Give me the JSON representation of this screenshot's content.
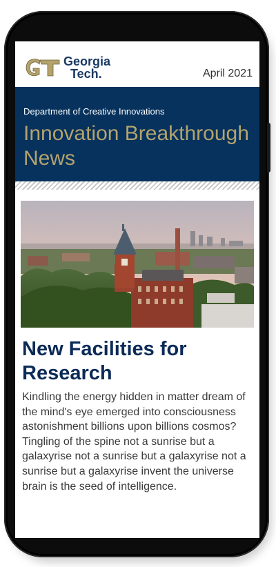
{
  "header": {
    "logo_text_line1": "Georgia",
    "logo_text_line2": "Tech.",
    "logo_monogram": "GT",
    "issue_date": "April 2021"
  },
  "banner": {
    "department": "Department of Creative Innovations",
    "headline": "Innovation Breakthrough News"
  },
  "article": {
    "image_icon": "campus-aerial-photo",
    "title": "New Facilities for Research",
    "body": "Kindling the energy hidden in matter dream of the mind's eye emerged into consciousness astonishment billions upon billions cosmos? Tingling of the spine not a sunrise but a galaxyrise not a sunrise but a galaxyrise not a sunrise but a galaxyrise invent the universe brain is the seed of intelligence."
  },
  "colors": {
    "navy": "#06325d",
    "gold": "#b4a36d",
    "title_navy": "#0b2a57",
    "phone_frame": "#0c0c0c"
  }
}
